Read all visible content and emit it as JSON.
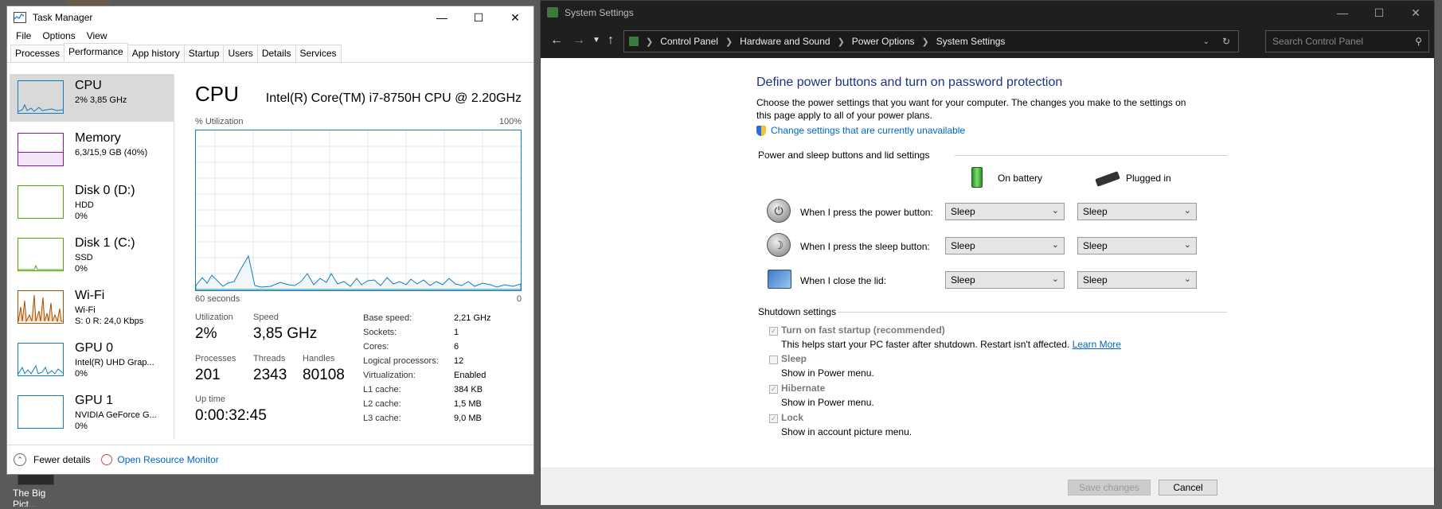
{
  "desktop": {
    "icon_label": "The Big Pict..."
  },
  "task_manager": {
    "title": "Task Manager",
    "menu": [
      "File",
      "Options",
      "View"
    ],
    "tabs": [
      "Processes",
      "Performance",
      "App history",
      "Startup",
      "Users",
      "Details",
      "Services"
    ],
    "active_tab": "Performance",
    "resources": [
      {
        "name": "CPU",
        "line1": "2% 3,85 GHz",
        "line2": "",
        "color": "#117dbb"
      },
      {
        "name": "Memory",
        "line1": "6,3/15,9 GB (40%)",
        "line2": "",
        "color": "#8b12ae"
      },
      {
        "name": "Disk 0 (D:)",
        "line1": "HDD",
        "line2": "0%",
        "color": "#4da60c"
      },
      {
        "name": "Disk 1 (C:)",
        "line1": "SSD",
        "line2": "0%",
        "color": "#4da60c"
      },
      {
        "name": "Wi-Fi",
        "line1": "Wi-Fi",
        "line2": "S: 0 R: 24,0 Kbps",
        "color": "#a74f01"
      },
      {
        "name": "GPU 0",
        "line1": "Intel(R) UHD Grap...",
        "line2": "0%",
        "color": "#117dbb"
      },
      {
        "name": "GPU 1",
        "line1": "NVIDIA GeForce G...",
        "line2": "0%",
        "color": "#117dbb"
      }
    ],
    "detail": {
      "title": "CPU",
      "model": "Intel(R) Core(TM) i7-8750H CPU @ 2.20GHz",
      "util_label": "% Utilization",
      "max_label": "100%",
      "time_label": "60 seconds",
      "min_label": "0",
      "utilization_label": "Utilization",
      "utilization": "2%",
      "speed_label": "Speed",
      "speed": "3,85 GHz",
      "processes_label": "Processes",
      "processes": "201",
      "threads_label": "Threads",
      "threads": "2343",
      "handles_label": "Handles",
      "handles": "80108",
      "uptime_label": "Up time",
      "uptime": "0:00:32:45",
      "specs": [
        {
          "k": "Base speed:",
          "v": "2,21 GHz",
          "bold": false
        },
        {
          "k": "Sockets:",
          "v": "1",
          "bold": false
        },
        {
          "k": "Cores:",
          "v": "6",
          "bold": false
        },
        {
          "k": "Logical processors:",
          "v": "12",
          "bold": false
        },
        {
          "k": "Virtualization:",
          "v": "Enabled",
          "bold": false
        },
        {
          "k": "L1 cache:",
          "v": "384 KB",
          "bold": false
        },
        {
          "k": "L2 cache:",
          "v": "1,5 MB",
          "bold": false
        },
        {
          "k": "L3 cache:",
          "v": "9,0 MB",
          "bold": false
        }
      ]
    },
    "footer": {
      "fewer_details": "Fewer details",
      "resource_monitor": "Open Resource Monitor"
    }
  },
  "system_settings": {
    "title": "System Settings",
    "breadcrumb": [
      "Control Panel",
      "Hardware and Sound",
      "Power Options",
      "System Settings"
    ],
    "search_placeholder": "Search Control Panel",
    "heading": "Define power buttons and turn on password protection",
    "description": "Choose the power settings that you want for your computer. The changes you make to the settings on this page apply to all of your power plans.",
    "change_link": "Change settings that are currently unavailable",
    "power_section": "Power and sleep buttons and lid settings",
    "on_battery": "On battery",
    "plugged_in": "Plugged in",
    "rows": [
      {
        "label": "When I press the power button:",
        "battery": "Sleep",
        "plugged": "Sleep"
      },
      {
        "label": "When I press the sleep button:",
        "battery": "Sleep",
        "plugged": "Sleep"
      },
      {
        "label": "When I close the lid:",
        "battery": "Sleep",
        "plugged": "Sleep"
      }
    ],
    "shutdown_section": "Shutdown settings",
    "shutdown": [
      {
        "label": "Turn on fast startup (recommended)",
        "checked": true,
        "desc": "This helps start your PC faster after shutdown. Restart isn't affected.",
        "link": "Learn More"
      },
      {
        "label": "Sleep",
        "checked": false,
        "desc": "Show in Power menu.",
        "link": ""
      },
      {
        "label": "Hibernate",
        "checked": true,
        "desc": "Show in Power menu.",
        "link": ""
      },
      {
        "label": "Lock",
        "checked": true,
        "desc": "Show in account picture menu.",
        "link": ""
      }
    ],
    "save_label": "Save changes",
    "cancel_label": "Cancel"
  }
}
